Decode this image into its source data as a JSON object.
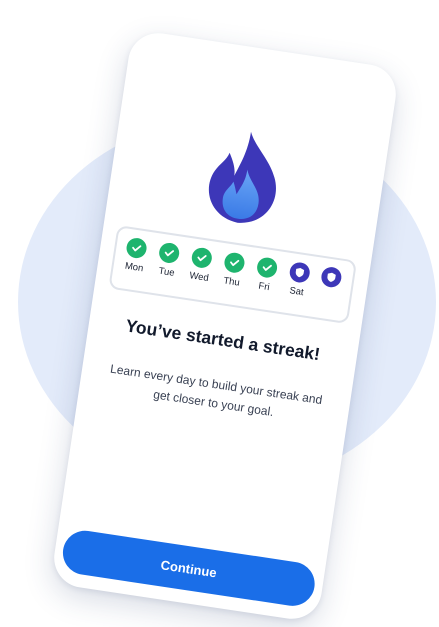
{
  "streak_screen": {
    "title": "You’ve started a streak!",
    "subtitle": "Learn every day to build your streak and get closer to your goal.",
    "continue_label": "Continue",
    "flame_icon": "flame-icon",
    "days": [
      {
        "label": "Mon",
        "state": "completed",
        "icon": "check-icon"
      },
      {
        "label": "Tue",
        "state": "completed",
        "icon": "check-icon"
      },
      {
        "label": "Wed",
        "state": "completed",
        "icon": "check-icon"
      },
      {
        "label": "Thu",
        "state": "completed",
        "icon": "check-icon"
      },
      {
        "label": "Fri",
        "state": "completed",
        "icon": "check-icon"
      },
      {
        "label": "Sat",
        "state": "freeze",
        "icon": "shield-icon"
      },
      {
        "label": "",
        "state": "freeze",
        "icon": "shield-icon"
      }
    ]
  },
  "colors": {
    "primary": "#1a6ee8",
    "completed": "#1eb46e",
    "freeze": "#3d37b8",
    "flame_outer": "#3d37b8",
    "flame_inner": "#4a8ff0",
    "background_blob": "#e3ebfa"
  }
}
